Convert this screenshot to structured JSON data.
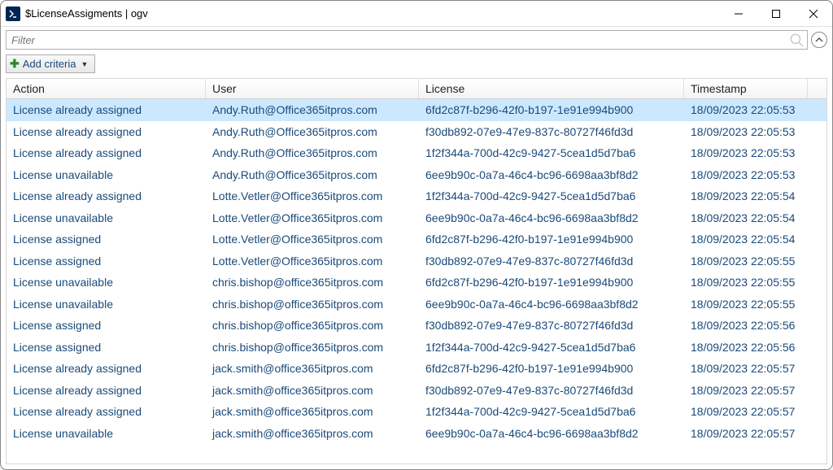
{
  "window": {
    "title": "$LicenseAssigments | ogv",
    "icon_label": "powershell-icon"
  },
  "filter": {
    "placeholder": "Filter"
  },
  "criteria": {
    "add_label": "Add criteria"
  },
  "grid": {
    "headers": {
      "action": "Action",
      "user": "User",
      "license": "License",
      "timestamp": "Timestamp"
    },
    "rows": [
      {
        "action": "License already assigned",
        "user": "Andy.Ruth@Office365itpros.com",
        "license": "6fd2c87f-b296-42f0-b197-1e91e994b900",
        "timestamp": "18/09/2023 22:05:53",
        "selected": true
      },
      {
        "action": "License already assigned",
        "user": "Andy.Ruth@Office365itpros.com",
        "license": "f30db892-07e9-47e9-837c-80727f46fd3d",
        "timestamp": "18/09/2023 22:05:53",
        "selected": false
      },
      {
        "action": "License already assigned",
        "user": "Andy.Ruth@Office365itpros.com",
        "license": "1f2f344a-700d-42c9-9427-5cea1d5d7ba6",
        "timestamp": "18/09/2023 22:05:53",
        "selected": false
      },
      {
        "action": "License unavailable",
        "user": "Andy.Ruth@Office365itpros.com",
        "license": "6ee9b90c-0a7a-46c4-bc96-6698aa3bf8d2",
        "timestamp": "18/09/2023 22:05:53",
        "selected": false
      },
      {
        "action": "License already assigned",
        "user": "Lotte.Vetler@Office365itpros.com",
        "license": "1f2f344a-700d-42c9-9427-5cea1d5d7ba6",
        "timestamp": "18/09/2023 22:05:54",
        "selected": false
      },
      {
        "action": "License unavailable",
        "user": "Lotte.Vetler@Office365itpros.com",
        "license": "6ee9b90c-0a7a-46c4-bc96-6698aa3bf8d2",
        "timestamp": "18/09/2023 22:05:54",
        "selected": false
      },
      {
        "action": "License assigned",
        "user": "Lotte.Vetler@Office365itpros.com",
        "license": "6fd2c87f-b296-42f0-b197-1e91e994b900",
        "timestamp": "18/09/2023 22:05:54",
        "selected": false
      },
      {
        "action": "License assigned",
        "user": "Lotte.Vetler@Office365itpros.com",
        "license": "f30db892-07e9-47e9-837c-80727f46fd3d",
        "timestamp": "18/09/2023 22:05:55",
        "selected": false
      },
      {
        "action": "License unavailable",
        "user": "chris.bishop@office365itpros.com",
        "license": "6fd2c87f-b296-42f0-b197-1e91e994b900",
        "timestamp": "18/09/2023 22:05:55",
        "selected": false
      },
      {
        "action": "License unavailable",
        "user": "chris.bishop@office365itpros.com",
        "license": "6ee9b90c-0a7a-46c4-bc96-6698aa3bf8d2",
        "timestamp": "18/09/2023 22:05:55",
        "selected": false
      },
      {
        "action": "License assigned",
        "user": "chris.bishop@office365itpros.com",
        "license": "f30db892-07e9-47e9-837c-80727f46fd3d",
        "timestamp": "18/09/2023 22:05:56",
        "selected": false
      },
      {
        "action": "License assigned",
        "user": "chris.bishop@office365itpros.com",
        "license": "1f2f344a-700d-42c9-9427-5cea1d5d7ba6",
        "timestamp": "18/09/2023 22:05:56",
        "selected": false
      },
      {
        "action": "License already assigned",
        "user": "jack.smith@office365itpros.com",
        "license": "6fd2c87f-b296-42f0-b197-1e91e994b900",
        "timestamp": "18/09/2023 22:05:57",
        "selected": false
      },
      {
        "action": "License already assigned",
        "user": "jack.smith@office365itpros.com",
        "license": "f30db892-07e9-47e9-837c-80727f46fd3d",
        "timestamp": "18/09/2023 22:05:57",
        "selected": false
      },
      {
        "action": "License already assigned",
        "user": "jack.smith@office365itpros.com",
        "license": "1f2f344a-700d-42c9-9427-5cea1d5d7ba6",
        "timestamp": "18/09/2023 22:05:57",
        "selected": false
      },
      {
        "action": "License unavailable",
        "user": "jack.smith@office365itpros.com",
        "license": "6ee9b90c-0a7a-46c4-bc96-6698aa3bf8d2",
        "timestamp": "18/09/2023 22:05:57",
        "selected": false
      }
    ]
  }
}
